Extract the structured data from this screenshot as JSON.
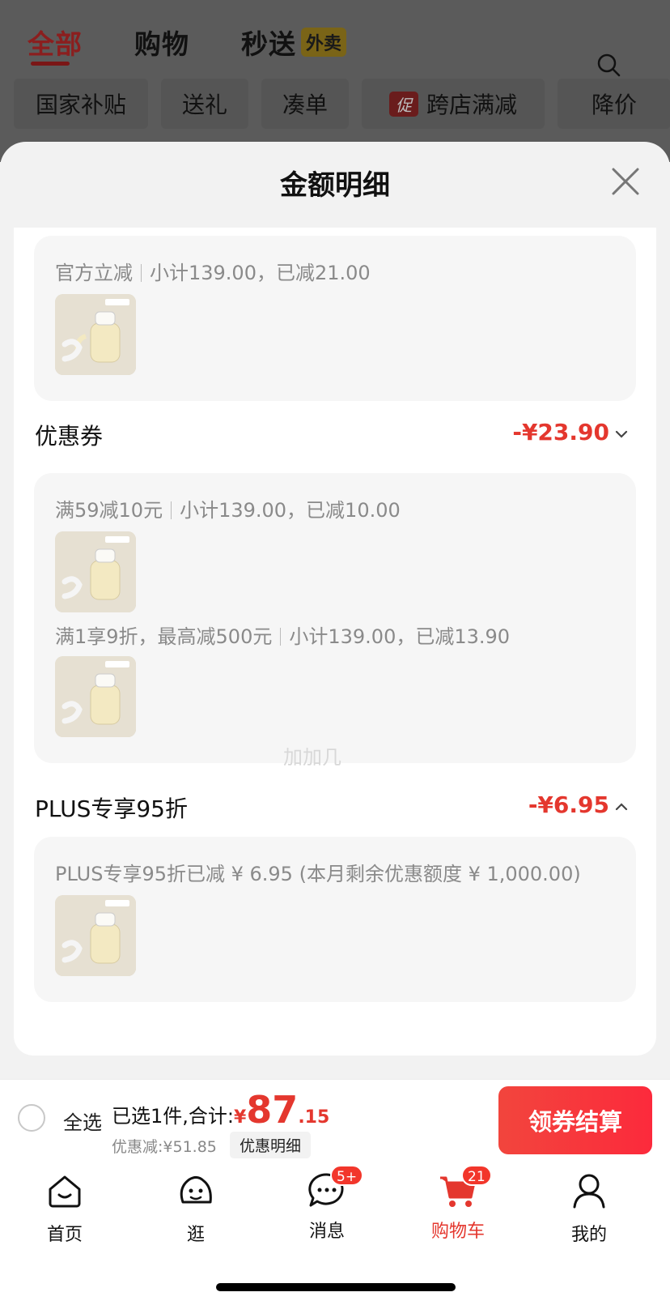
{
  "top_tabs": {
    "all": "全部",
    "shopping": "购物",
    "express": "秒送",
    "waimai_tag": "外卖"
  },
  "chips": {
    "subsidy": "国家补贴",
    "gift": "送礼",
    "together": "凑单",
    "promo_tag": "促",
    "cross_store": "跨店满减",
    "price_drop": "降价"
  },
  "sheet": {
    "title": "金额明细",
    "official": {
      "line_a": "官方立减",
      "line_b": "小计139.00，已减21.00"
    },
    "coupon": {
      "title": "优惠券",
      "amount": "-¥23.90",
      "rule1_a": "满59减10元",
      "rule1_b": "小计139.00，已减10.00",
      "rule2_a": "满1享9折，最高减500元",
      "rule2_b": "小计139.00，已减13.90"
    },
    "plus": {
      "title": "PLUS专享95折",
      "amount": "-¥6.95",
      "note": "PLUS专享95折已减 ¥ 6.95 (本月剩余优惠额度 ¥ 1,000.00)"
    },
    "watermark": "加加几"
  },
  "checkout": {
    "select_all": "全选",
    "summary": "已选1件,合计:",
    "currency": "¥",
    "total_int": "87",
    "total_dec": ".15",
    "discount": "优惠减:¥51.85",
    "detail_btn": "优惠明细",
    "checkout_btn": "领券结算"
  },
  "nav": {
    "home": "首页",
    "browse": "逛",
    "messages": "消息",
    "messages_badge": "5+",
    "cart": "购物车",
    "cart_badge": "21",
    "mine": "我的"
  },
  "colors": {
    "accent": "#e4372e",
    "overlay": "#5b5b5b"
  }
}
